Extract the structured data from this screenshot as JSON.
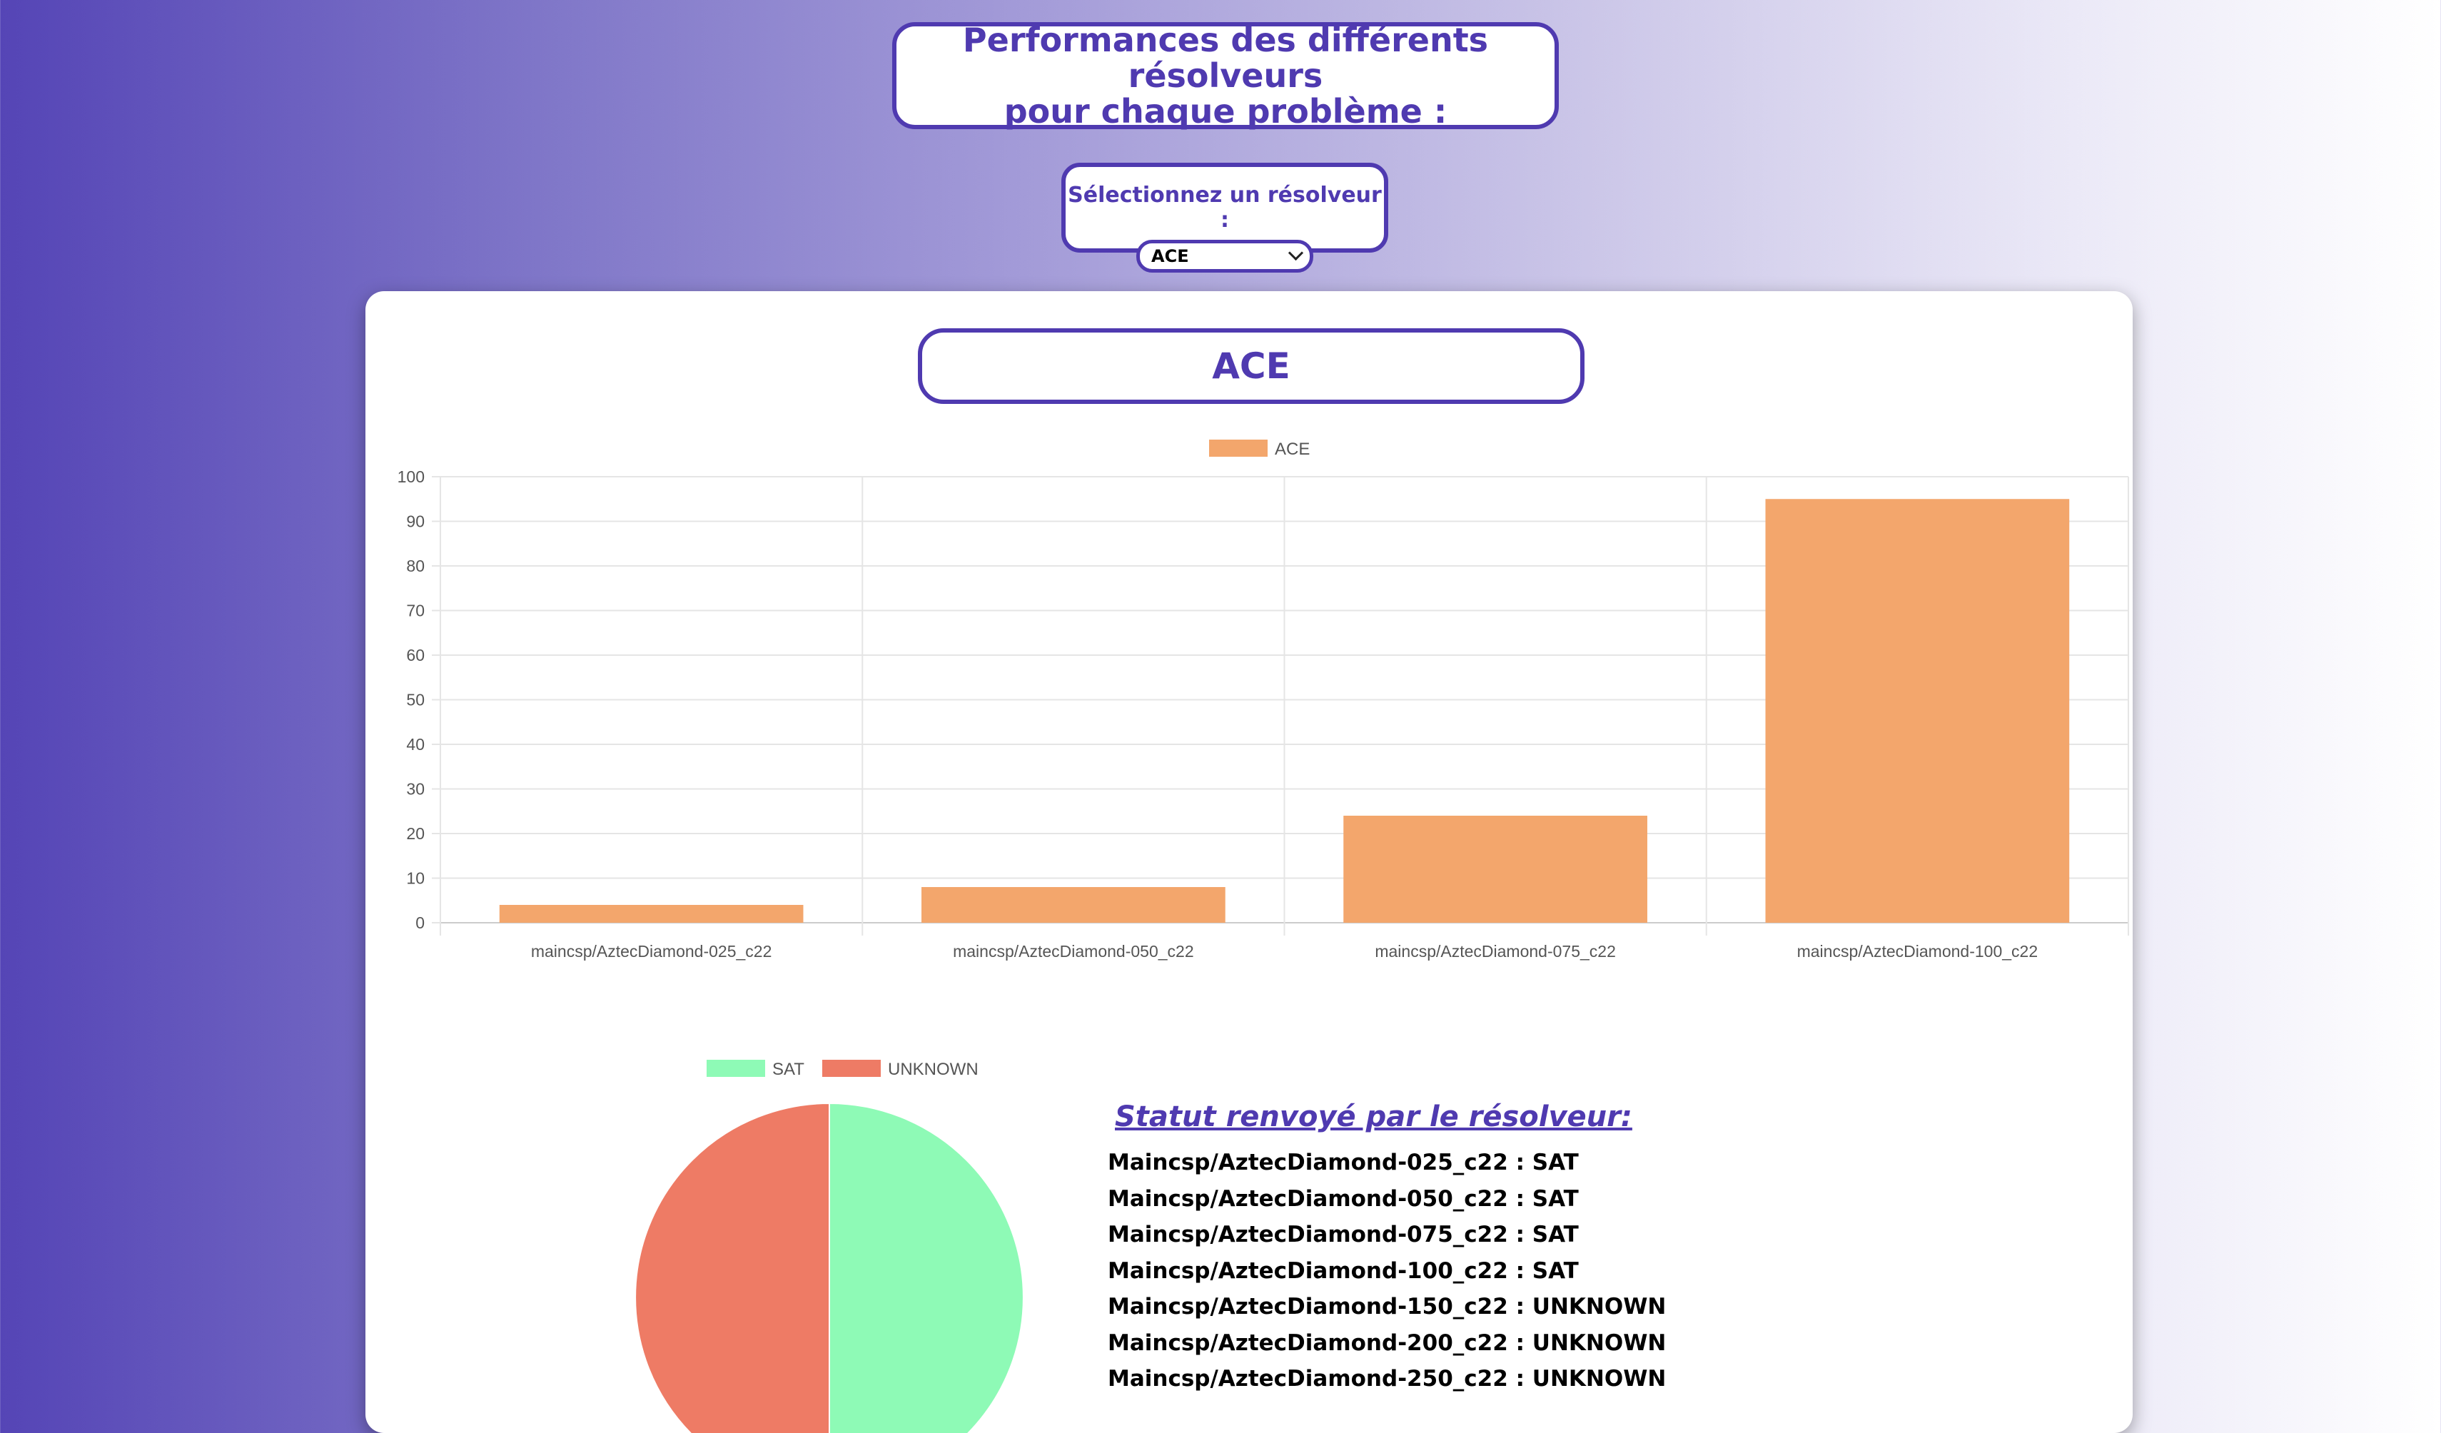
{
  "page": {
    "title_line1": "Performances des différents résolveurs",
    "title_line2": "pour chaque problème :"
  },
  "selector": {
    "label": "Sélectionnez un résolveur :",
    "selected": "ACE"
  },
  "card": {
    "solver_title": "ACE",
    "status_heading": "Statut renvoyé par le résolveur:",
    "status_lines": [
      "Maincsp/AztecDiamond-025_c22 : SAT",
      "Maincsp/AztecDiamond-050_c22 : SAT",
      "Maincsp/AztecDiamond-075_c22 : SAT",
      "Maincsp/AztecDiamond-100_c22 : SAT",
      "Maincsp/AztecDiamond-150_c22 : UNKNOWN",
      "Maincsp/AztecDiamond-200_c22 : UNKNOWN",
      "Maincsp/AztecDiamond-250_c22 : UNKNOWN"
    ]
  },
  "colors": {
    "accent": "#4f3ab0",
    "bar": "#f3a66c",
    "sat": "#8efab6",
    "unknown": "#ee7b65"
  },
  "chart_data": [
    {
      "type": "bar",
      "categories": [
        "maincsp/AztecDiamond-025_c22",
        "maincsp/AztecDiamond-050_c22",
        "maincsp/AztecDiamond-075_c22",
        "maincsp/AztecDiamond-100_c22"
      ],
      "series": [
        {
          "name": "ACE",
          "values": [
            4,
            8,
            24,
            95
          ]
        }
      ],
      "ylim": [
        0,
        100
      ],
      "yticks": [
        "0",
        "10",
        "20",
        "30",
        "40",
        "50",
        "60",
        "70",
        "80",
        "90",
        "100"
      ],
      "grid": true,
      "legend": "top-center"
    },
    {
      "type": "pie",
      "labels": [
        "SAT",
        "UNKNOWN"
      ],
      "values": [
        50,
        50
      ],
      "legend": "top-center"
    }
  ]
}
